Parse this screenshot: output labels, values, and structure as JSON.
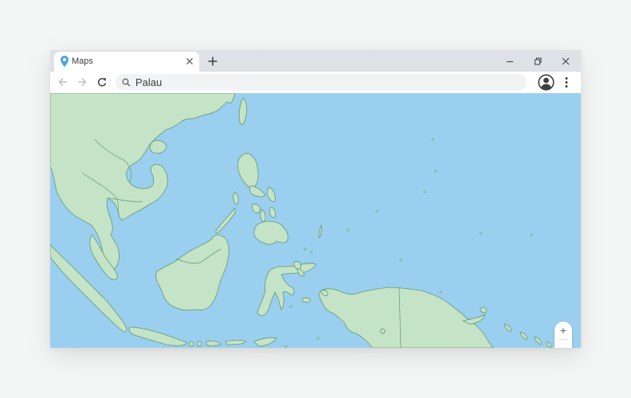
{
  "tab": {
    "title": "Maps"
  },
  "omnibox": {
    "query": "Palau"
  },
  "map": {
    "zoom_in_label": "+",
    "zoom_out_label": "−",
    "colors": {
      "water": "#9bcfef",
      "land": "#c5e3c7",
      "border": "#5f9a73"
    }
  },
  "colors": {
    "tabstrip": "#dee1e6",
    "pin": "#4aa3df",
    "icon": "#5f6368"
  }
}
